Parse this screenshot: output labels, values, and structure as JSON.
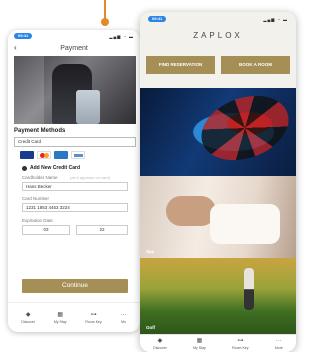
{
  "payment_screen": {
    "status_time": "09:41",
    "status_icons": "▂▄▆ ◔ ▬",
    "title": "Payment",
    "section_title": "Payment Methods",
    "method_selected": "Credit Card",
    "add_card_label": "Add New Credit Card",
    "cardholder_label": "Cardholder Name",
    "cardholder_hint": "(as it appears on card)",
    "cardholder_value": "Hans Becker",
    "card_number_label": "Card Number",
    "card_number_value": "1231 1853 4453 3224",
    "expiration_label": "Expiration Date",
    "exp_month": "03",
    "exp_year": "22",
    "continue_label": "Continue",
    "card_brands": [
      {
        "name": "visa",
        "color": "#1a3a8f"
      },
      {
        "name": "mastercard",
        "color": "#e8621d"
      },
      {
        "name": "amex",
        "color": "#2b78c5"
      },
      {
        "name": "other",
        "color": "#5d8fd0"
      }
    ],
    "tabs": [
      {
        "label": "Discover",
        "icon": "tag-icon"
      },
      {
        "label": "My Stay",
        "icon": "calendar-icon"
      },
      {
        "label": "Room Key",
        "icon": "key-icon"
      },
      {
        "label": "Mo",
        "icon": "more-icon"
      }
    ]
  },
  "home_screen": {
    "status_time": "09:41",
    "status_icons": "▂▄▆ ◔ ▬",
    "logo": "ZAPLOX",
    "buttons": [
      "FIND RESERVATION",
      "BOOK A ROOM"
    ],
    "tiles": [
      {
        "label": ""
      },
      {
        "label": "Spa"
      },
      {
        "label": "Golf"
      }
    ],
    "tabs": [
      {
        "label": "Discover",
        "icon": "tag-icon"
      },
      {
        "label": "My Stay",
        "icon": "calendar-icon"
      },
      {
        "label": "Room Key",
        "icon": "key-icon"
      },
      {
        "label": "More",
        "icon": "more-icon"
      }
    ]
  },
  "colors": {
    "accent_gold": "#a68f57",
    "time_pill": "#2a85e8",
    "connector": "#e08a2c"
  }
}
